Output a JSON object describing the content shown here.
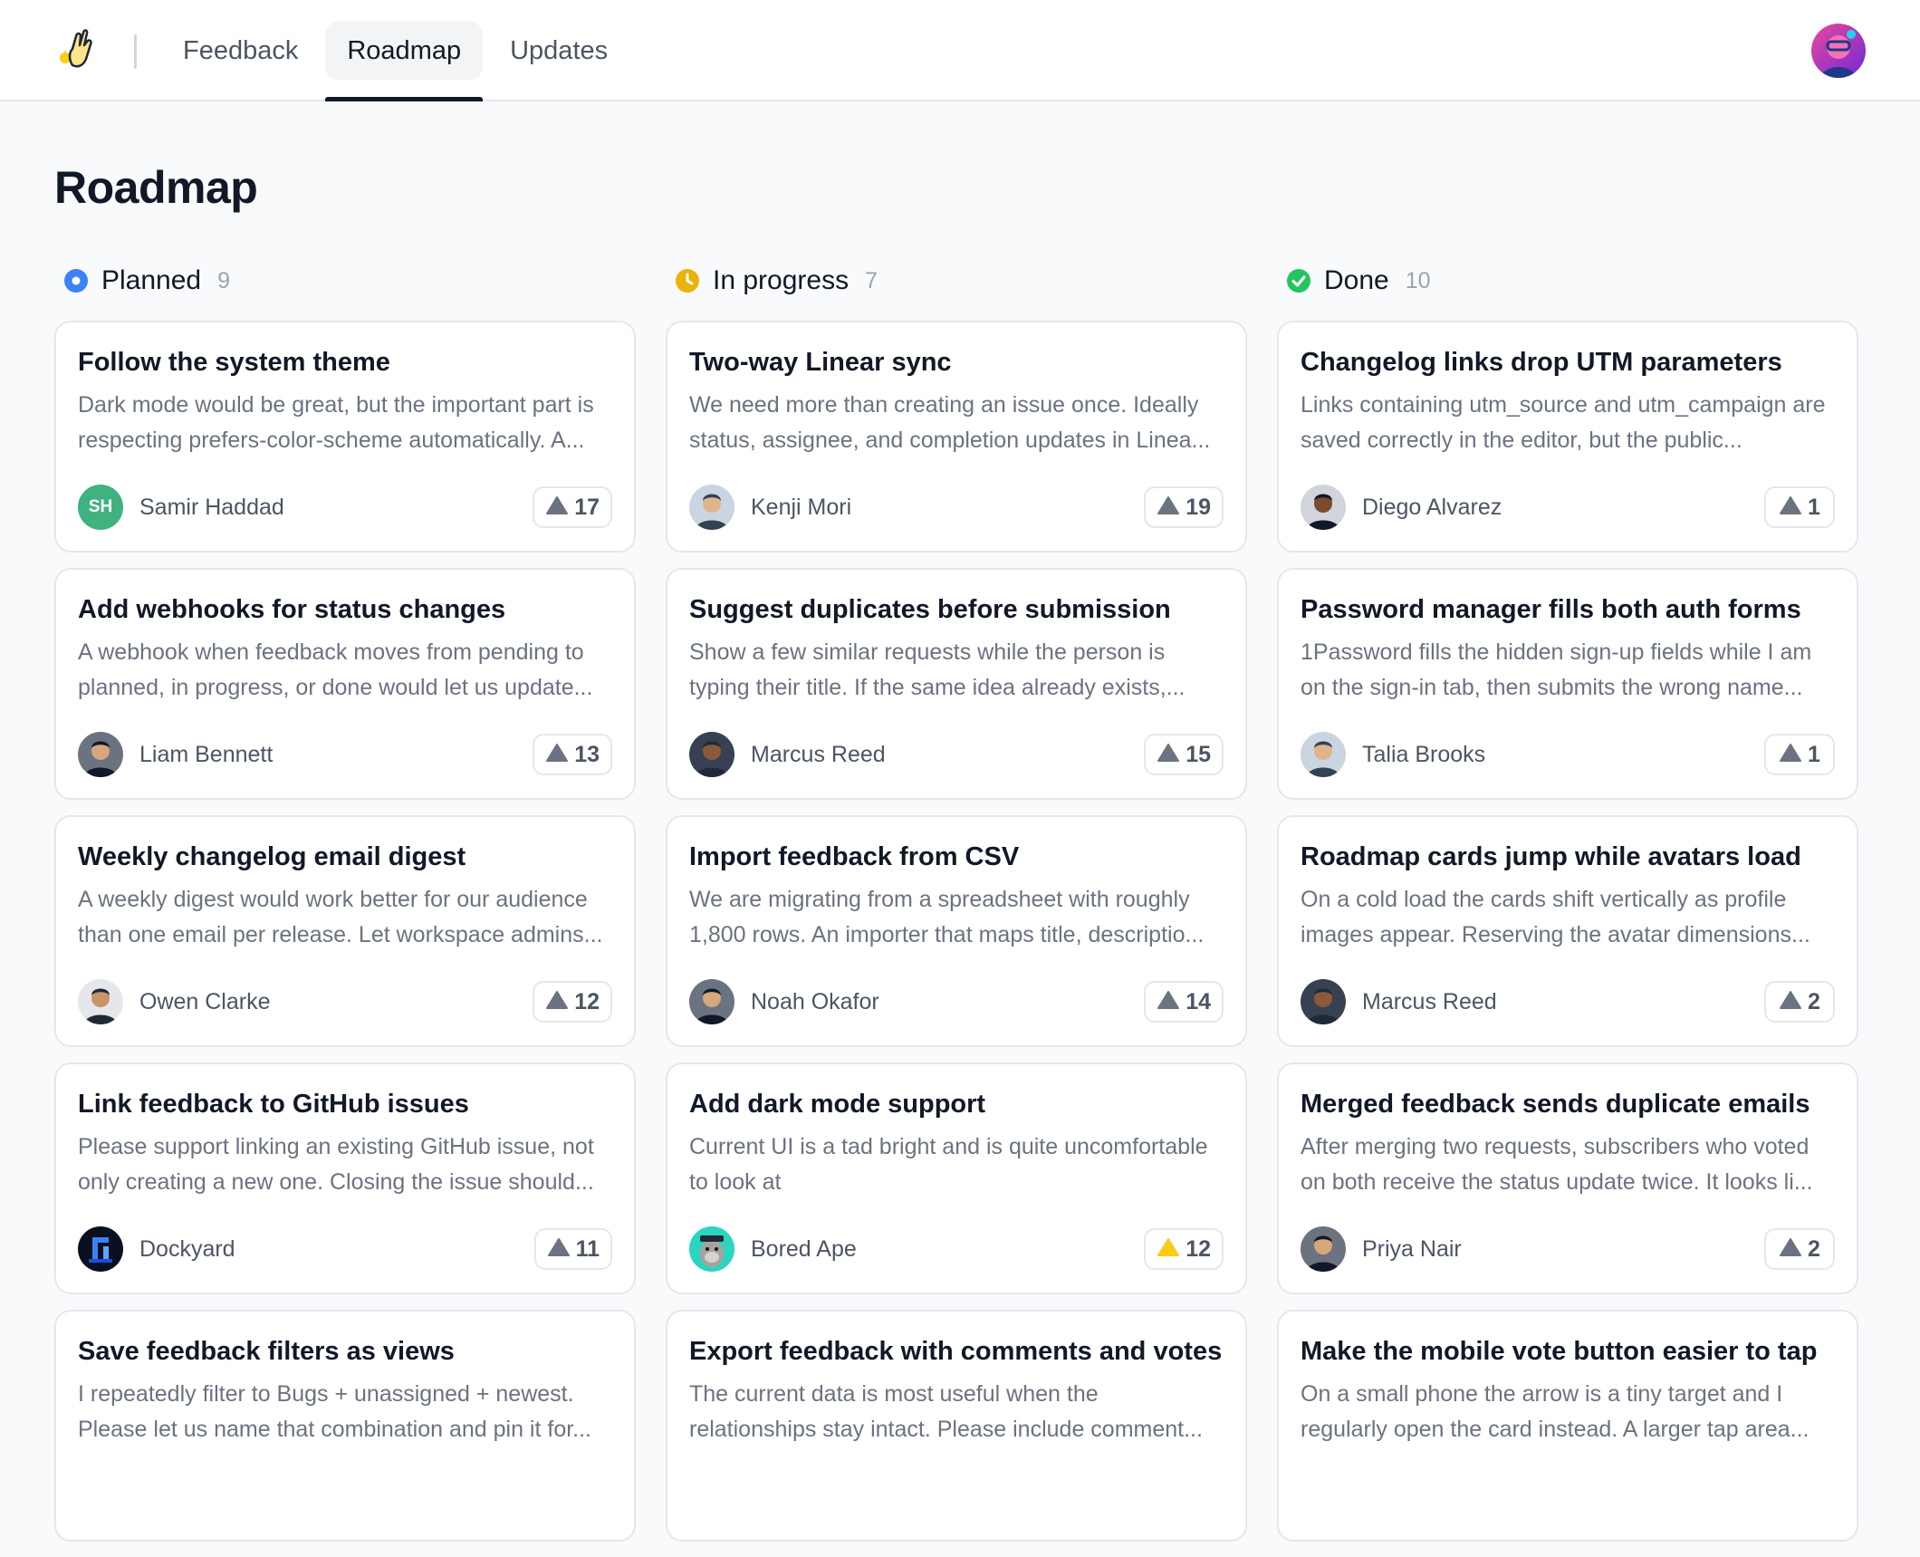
{
  "nav": {
    "tabs": [
      {
        "label": "Feedback",
        "active": false
      },
      {
        "label": "Roadmap",
        "active": true
      },
      {
        "label": "Updates",
        "active": false
      }
    ]
  },
  "page": {
    "title": "Roadmap"
  },
  "colors": {
    "planned": "#3b82f6",
    "in_progress": "#eab308",
    "done": "#22c55e",
    "vote_highlight": "#facc15"
  },
  "columns": [
    {
      "title": "Planned",
      "count": "9",
      "status_icon": "planned-dot-icon",
      "cards": [
        {
          "title": "Follow the system theme",
          "description": "Dark mode would be great, but the important part is respecting prefers-color-scheme automatically. A...",
          "author": "Samir Haddad",
          "avatar": "initials",
          "initials": "SH",
          "votes": "17"
        },
        {
          "title": "Add webhooks for status changes",
          "description": "A webhook when feedback moves from pending to planned, in progress, or done would let us update...",
          "author": "Liam Bennett",
          "avatar": "photo",
          "votes": "13"
        },
        {
          "title": "Weekly changelog email digest",
          "description": "A weekly digest would work better for our audience than one email per release. Let workspace admins...",
          "author": "Owen Clarke",
          "avatar": "photo",
          "votes": "12"
        },
        {
          "title": "Link feedback to GitHub issues",
          "description": "Please support linking an existing GitHub issue, not only creating a new one. Closing the issue should...",
          "author": "Dockyard",
          "avatar": "logo",
          "votes": "11"
        },
        {
          "title": "Save feedback filters as views",
          "description": "I repeatedly filter to Bugs + unassigned + newest. Please let us name that combination and pin it for...",
          "author": "",
          "avatar": "none",
          "votes": ""
        }
      ]
    },
    {
      "title": "In progress",
      "count": "7",
      "status_icon": "in-progress-clock-icon",
      "cards": [
        {
          "title": "Two-way Linear sync",
          "description": "We need more than creating an issue once. Ideally status, assignee, and completion updates in Linea...",
          "author": "Kenji Mori",
          "avatar": "photo",
          "votes": "19"
        },
        {
          "title": "Suggest duplicates before submission",
          "description": "Show a few similar requests while the person is typing their title. If the same idea already exists,...",
          "author": "Marcus Reed",
          "avatar": "photo",
          "votes": "15"
        },
        {
          "title": "Import feedback from CSV",
          "description": "We are migrating from a spreadsheet with roughly 1,800 rows. An importer that maps title, descriptio...",
          "author": "Noah Okafor",
          "avatar": "photo",
          "votes": "14"
        },
        {
          "title": "Add dark mode support",
          "description": "Current UI is a tad bright and is quite uncomfortable to look at",
          "author": "Bored Ape",
          "avatar": "ape",
          "votes": "12",
          "voted": true
        },
        {
          "title": "Export feedback with comments and votes",
          "description": "The current data is most useful when the relationships stay intact. Please include comment...",
          "author": "",
          "avatar": "none",
          "votes": ""
        }
      ]
    },
    {
      "title": "Done",
      "count": "10",
      "status_icon": "done-check-icon",
      "cards": [
        {
          "title": "Changelog links drop UTM parameters",
          "description": "Links containing utm_source and utm_campaign are saved correctly in the editor, but the public...",
          "author": "Diego Alvarez",
          "avatar": "photo",
          "votes": "1"
        },
        {
          "title": "Password manager fills both auth forms",
          "description": "1Password fills the hidden sign-up fields while I am on the sign-in tab, then submits the wrong name...",
          "author": "Talia Brooks",
          "avatar": "photo",
          "votes": "1"
        },
        {
          "title": "Roadmap cards jump while avatars load",
          "description": "On a cold load the cards shift vertically as profile images appear. Reserving the avatar dimensions...",
          "author": "Marcus Reed",
          "avatar": "photo",
          "votes": "2"
        },
        {
          "title": "Merged feedback sends duplicate emails",
          "description": "After merging two requests, subscribers who voted on both receive the status update twice. It looks li...",
          "author": "Priya Nair",
          "avatar": "photo",
          "votes": "2"
        },
        {
          "title": "Make the mobile vote button easier to tap",
          "description": "On a small phone the arrow is a tiny target and I regularly open the card instead. A larger tap area...",
          "author": "",
          "avatar": "none",
          "votes": ""
        }
      ]
    }
  ]
}
